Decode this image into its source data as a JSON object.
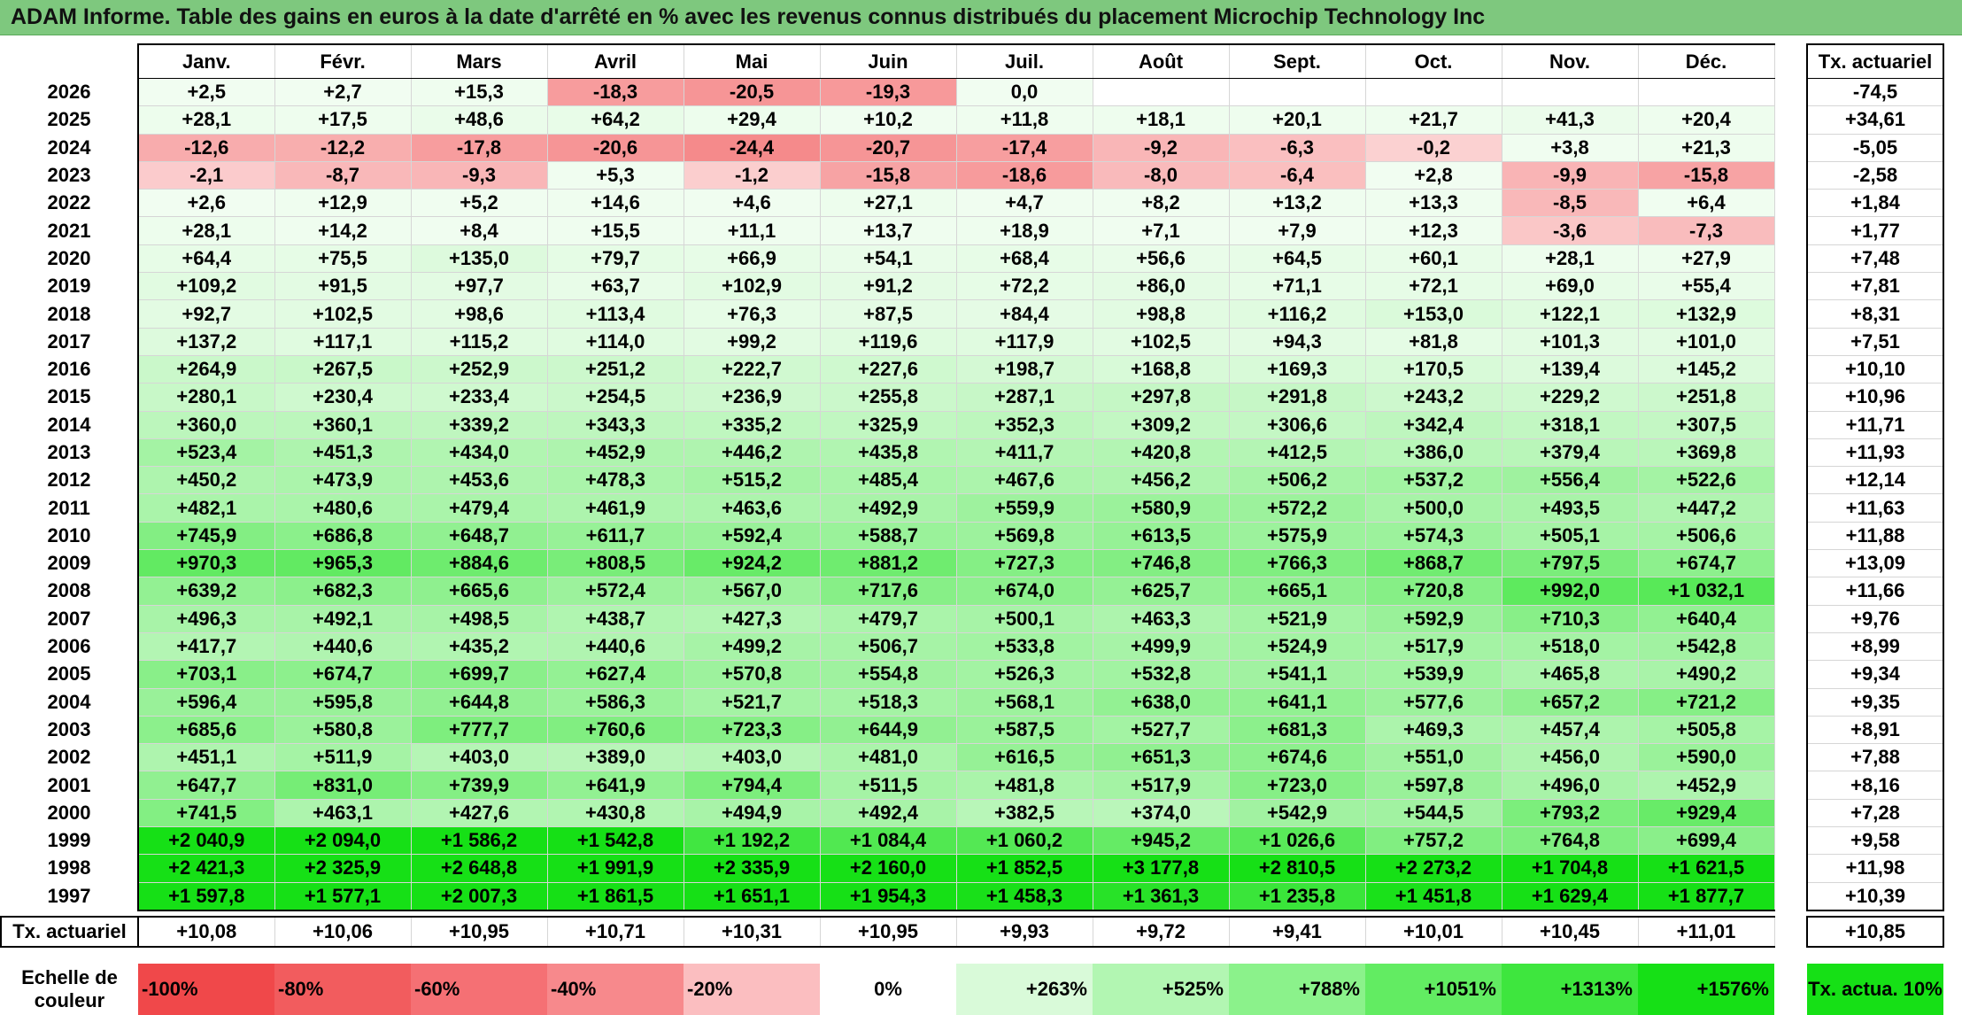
{
  "title": "ADAM Informe. Table des gains en euros à la date d'arrêté en % avec les revenus connus distribués du placement Microchip Technology Inc",
  "months": [
    "Janv.",
    "Févr.",
    "Mars",
    "Avril",
    "Mai",
    "Juin",
    "Juil.",
    "Août",
    "Sept.",
    "Oct.",
    "Nov.",
    "Déc."
  ],
  "tx_header": "Tx. actuariel",
  "rows": [
    {
      "year": "2026",
      "values": [
        "+2,5",
        "+2,7",
        "+15,3",
        "-18,3",
        "-20,5",
        "-19,3",
        "0,0",
        "",
        "",
        "",
        "",
        ""
      ],
      "tx": "-74,5"
    },
    {
      "year": "2025",
      "values": [
        "+28,1",
        "+17,5",
        "+48,6",
        "+64,2",
        "+29,4",
        "+10,2",
        "+11,8",
        "+18,1",
        "+20,1",
        "+21,7",
        "+41,3",
        "+20,4"
      ],
      "tx": "+34,61"
    },
    {
      "year": "2024",
      "values": [
        "-12,6",
        "-12,2",
        "-17,8",
        "-20,6",
        "-24,4",
        "-20,7",
        "-17,4",
        "-9,2",
        "-6,3",
        "-0,2",
        "+3,8",
        "+21,3"
      ],
      "tx": "-5,05"
    },
    {
      "year": "2023",
      "values": [
        "-2,1",
        "-8,7",
        "-9,3",
        "+5,3",
        "-1,2",
        "-15,8",
        "-18,6",
        "-8,0",
        "-6,4",
        "+2,8",
        "-9,9",
        "-15,8"
      ],
      "tx": "-2,58"
    },
    {
      "year": "2022",
      "values": [
        "+2,6",
        "+12,9",
        "+5,2",
        "+14,6",
        "+4,6",
        "+27,1",
        "+4,7",
        "+8,2",
        "+13,2",
        "+13,3",
        "-8,5",
        "+6,4"
      ],
      "tx": "+1,84"
    },
    {
      "year": "2021",
      "values": [
        "+28,1",
        "+14,2",
        "+8,4",
        "+15,5",
        "+11,1",
        "+13,7",
        "+18,9",
        "+7,1",
        "+7,9",
        "+12,3",
        "-3,6",
        "-7,3"
      ],
      "tx": "+1,77"
    },
    {
      "year": "2020",
      "values": [
        "+64,4",
        "+75,5",
        "+135,0",
        "+79,7",
        "+66,9",
        "+54,1",
        "+68,4",
        "+56,6",
        "+64,5",
        "+60,1",
        "+28,1",
        "+27,9"
      ],
      "tx": "+7,48"
    },
    {
      "year": "2019",
      "values": [
        "+109,2",
        "+91,5",
        "+97,7",
        "+63,7",
        "+102,9",
        "+91,2",
        "+72,2",
        "+86,0",
        "+71,1",
        "+72,1",
        "+69,0",
        "+55,4"
      ],
      "tx": "+7,81"
    },
    {
      "year": "2018",
      "values": [
        "+92,7",
        "+102,5",
        "+98,6",
        "+113,4",
        "+76,3",
        "+87,5",
        "+84,4",
        "+98,8",
        "+116,2",
        "+153,0",
        "+122,1",
        "+132,9"
      ],
      "tx": "+8,31"
    },
    {
      "year": "2017",
      "values": [
        "+137,2",
        "+117,1",
        "+115,2",
        "+114,0",
        "+99,2",
        "+119,6",
        "+117,9",
        "+102,5",
        "+94,3",
        "+81,8",
        "+101,3",
        "+101,0"
      ],
      "tx": "+7,51"
    },
    {
      "year": "2016",
      "values": [
        "+264,9",
        "+267,5",
        "+252,9",
        "+251,2",
        "+222,7",
        "+227,6",
        "+198,7",
        "+168,8",
        "+169,3",
        "+170,5",
        "+139,4",
        "+145,2"
      ],
      "tx": "+10,10"
    },
    {
      "year": "2015",
      "values": [
        "+280,1",
        "+230,4",
        "+233,4",
        "+254,5",
        "+236,9",
        "+255,8",
        "+287,1",
        "+297,8",
        "+291,8",
        "+243,2",
        "+229,2",
        "+251,8"
      ],
      "tx": "+10,96"
    },
    {
      "year": "2014",
      "values": [
        "+360,0",
        "+360,1",
        "+339,2",
        "+343,3",
        "+335,2",
        "+325,9",
        "+352,3",
        "+309,2",
        "+306,6",
        "+342,4",
        "+318,1",
        "+307,5"
      ],
      "tx": "+11,71"
    },
    {
      "year": "2013",
      "values": [
        "+523,4",
        "+451,3",
        "+434,0",
        "+452,9",
        "+446,2",
        "+435,8",
        "+411,7",
        "+420,8",
        "+412,5",
        "+386,0",
        "+379,4",
        "+369,8"
      ],
      "tx": "+11,93"
    },
    {
      "year": "2012",
      "values": [
        "+450,2",
        "+473,9",
        "+453,6",
        "+478,3",
        "+515,2",
        "+485,4",
        "+467,6",
        "+456,2",
        "+506,2",
        "+537,2",
        "+556,4",
        "+522,6"
      ],
      "tx": "+12,14"
    },
    {
      "year": "2011",
      "values": [
        "+482,1",
        "+480,6",
        "+479,4",
        "+461,9",
        "+463,6",
        "+492,9",
        "+559,9",
        "+580,9",
        "+572,2",
        "+500,0",
        "+493,5",
        "+447,2"
      ],
      "tx": "+11,63"
    },
    {
      "year": "2010",
      "values": [
        "+745,9",
        "+686,8",
        "+648,7",
        "+611,7",
        "+592,4",
        "+588,7",
        "+569,8",
        "+613,5",
        "+575,9",
        "+574,3",
        "+505,1",
        "+506,6"
      ],
      "tx": "+11,88"
    },
    {
      "year": "2009",
      "values": [
        "+970,3",
        "+965,3",
        "+884,6",
        "+808,5",
        "+924,2",
        "+881,2",
        "+727,3",
        "+746,8",
        "+766,3",
        "+868,7",
        "+797,5",
        "+674,7"
      ],
      "tx": "+13,09"
    },
    {
      "year": "2008",
      "values": [
        "+639,2",
        "+682,3",
        "+665,6",
        "+572,4",
        "+567,0",
        "+717,6",
        "+674,0",
        "+625,7",
        "+665,1",
        "+720,8",
        "+992,0",
        "+1 032,1"
      ],
      "tx": "+11,66"
    },
    {
      "year": "2007",
      "values": [
        "+496,3",
        "+492,1",
        "+498,5",
        "+438,7",
        "+427,3",
        "+479,7",
        "+500,1",
        "+463,3",
        "+521,9",
        "+592,9",
        "+710,3",
        "+640,4"
      ],
      "tx": "+9,76"
    },
    {
      "year": "2006",
      "values": [
        "+417,7",
        "+440,6",
        "+435,2",
        "+440,6",
        "+499,2",
        "+506,7",
        "+533,8",
        "+499,9",
        "+524,9",
        "+517,9",
        "+518,0",
        "+542,8"
      ],
      "tx": "+8,99"
    },
    {
      "year": "2005",
      "values": [
        "+703,1",
        "+674,7",
        "+699,7",
        "+627,4",
        "+570,8",
        "+554,8",
        "+526,3",
        "+532,8",
        "+541,1",
        "+539,9",
        "+465,8",
        "+490,2"
      ],
      "tx": "+9,34"
    },
    {
      "year": "2004",
      "values": [
        "+596,4",
        "+595,8",
        "+644,8",
        "+586,3",
        "+521,7",
        "+518,3",
        "+568,1",
        "+638,0",
        "+641,1",
        "+577,6",
        "+657,2",
        "+721,2"
      ],
      "tx": "+9,35"
    },
    {
      "year": "2003",
      "values": [
        "+685,6",
        "+580,8",
        "+777,7",
        "+760,6",
        "+723,3",
        "+644,9",
        "+587,5",
        "+527,7",
        "+681,3",
        "+469,3",
        "+457,4",
        "+505,8"
      ],
      "tx": "+8,91"
    },
    {
      "year": "2002",
      "values": [
        "+451,1",
        "+511,9",
        "+403,0",
        "+389,0",
        "+403,0",
        "+481,0",
        "+616,5",
        "+651,3",
        "+674,6",
        "+551,0",
        "+456,0",
        "+590,0"
      ],
      "tx": "+7,88"
    },
    {
      "year": "2001",
      "values": [
        "+647,7",
        "+831,0",
        "+739,9",
        "+641,9",
        "+794,4",
        "+511,5",
        "+481,8",
        "+517,9",
        "+723,0",
        "+597,8",
        "+496,0",
        "+452,9"
      ],
      "tx": "+8,16"
    },
    {
      "year": "2000",
      "values": [
        "+741,5",
        "+463,1",
        "+427,6",
        "+430,8",
        "+494,9",
        "+492,4",
        "+382,5",
        "+374,0",
        "+542,9",
        "+544,5",
        "+793,2",
        "+929,4"
      ],
      "tx": "+7,28"
    },
    {
      "year": "1999",
      "values": [
        "+2 040,9",
        "+2 094,0",
        "+1 586,2",
        "+1 542,8",
        "+1 192,2",
        "+1 084,4",
        "+1 060,2",
        "+945,2",
        "+1 026,6",
        "+757,2",
        "+764,8",
        "+699,4"
      ],
      "tx": "+9,58"
    },
    {
      "year": "1998",
      "values": [
        "+2 421,3",
        "+2 325,9",
        "+2 648,8",
        "+1 991,9",
        "+2 335,9",
        "+2 160,0",
        "+1 852,5",
        "+3 177,8",
        "+2 810,5",
        "+2 273,2",
        "+1 704,8",
        "+1 621,5"
      ],
      "tx": "+11,98"
    },
    {
      "year": "1997",
      "values": [
        "+1 597,8",
        "+1 577,1",
        "+2 007,3",
        "+1 861,5",
        "+1 651,1",
        "+1 954,3",
        "+1 458,3",
        "+1 361,3",
        "+1 235,8",
        "+1 451,8",
        "+1 629,4",
        "+1 877,7"
      ],
      "tx": "+10,39"
    }
  ],
  "summary": {
    "label": "Tx. actuariel",
    "values": [
      "+10,08",
      "+10,06",
      "+10,95",
      "+10,71",
      "+10,31",
      "+10,95",
      "+9,93",
      "+9,72",
      "+9,41",
      "+10,01",
      "+10,45",
      "+11,01"
    ],
    "tx": "+10,85"
  },
  "scale": {
    "label": "Echelle de couleur",
    "items": [
      {
        "text": "-100%",
        "color": "#f0484a"
      },
      {
        "text": "-80%",
        "color": "#f25c5e"
      },
      {
        "text": "-60%",
        "color": "#f57074"
      },
      {
        "text": "-40%",
        "color": "#f7898c"
      },
      {
        "text": "-20%",
        "color": "#fbbec0"
      },
      {
        "text": "0%",
        "color": "#ffffff"
      },
      {
        "text": "+263%",
        "color": "#d9fad9"
      },
      {
        "text": "+525%",
        "color": "#b2f6b2"
      },
      {
        "text": "+788%",
        "color": "#8bf28b"
      },
      {
        "text": "+1051%",
        "color": "#62ec62"
      },
      {
        "text": "+1313%",
        "color": "#3ee63e"
      },
      {
        "text": "+1576%",
        "color": "#16e016"
      }
    ],
    "tx_label": "Tx. actua. 10%",
    "tx_color": "#16e016"
  },
  "colors": {
    "title_bg": "#7ec87e",
    "negative_max": "#f0484a",
    "positive_max": "#16e016"
  }
}
